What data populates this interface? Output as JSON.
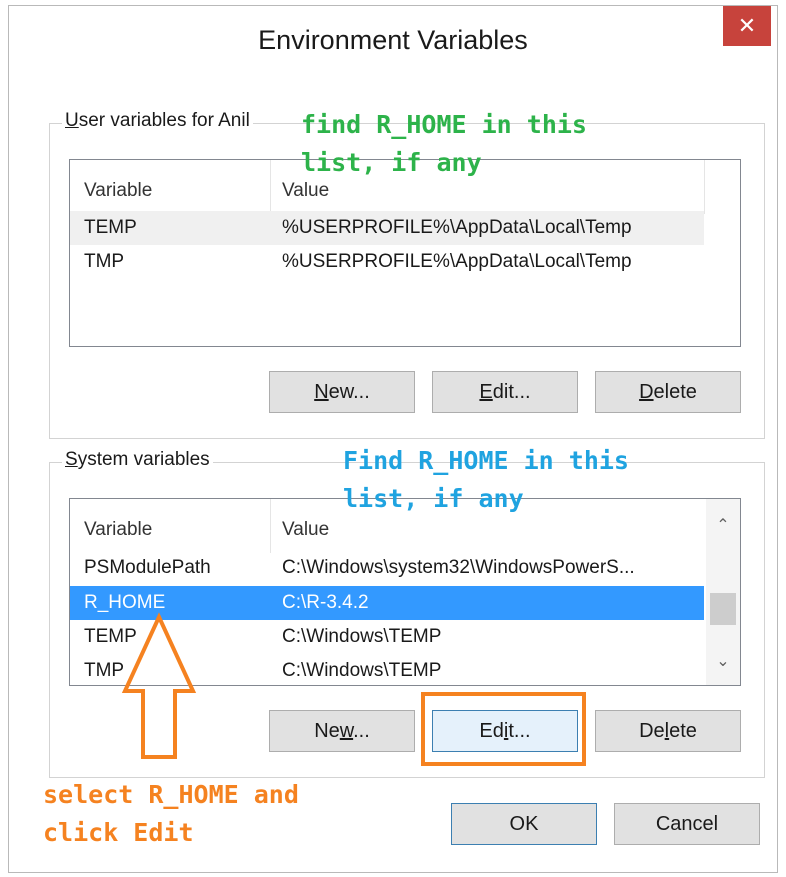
{
  "window": {
    "title": "Environment Variables",
    "close_glyph": "✕"
  },
  "user_group": {
    "label_prefix": "",
    "label_accel": "U",
    "label_rest": "ser variables for Anil",
    "columns": [
      "Variable",
      "Value"
    ],
    "rows": [
      {
        "variable": "TEMP",
        "value": "%USERPROFILE%\\AppData\\Local\\Temp"
      },
      {
        "variable": "TMP",
        "value": "%USERPROFILE%\\AppData\\Local\\Temp"
      }
    ],
    "buttons": {
      "new": {
        "pre": "",
        "accel": "N",
        "post": "ew..."
      },
      "edit": {
        "pre": "",
        "accel": "E",
        "post": "dit..."
      },
      "delete": {
        "pre": "",
        "accel": "D",
        "post": "elete"
      }
    }
  },
  "system_group": {
    "label_prefix": "",
    "label_accel": "S",
    "label_rest": "ystem variables",
    "columns": [
      "Variable",
      "Value"
    ],
    "rows": [
      {
        "variable": "PSModulePath",
        "value": "C:\\Windows\\system32\\WindowsPowerS..."
      },
      {
        "variable": "R_HOME",
        "value": "C:\\R-3.4.2"
      },
      {
        "variable": "TEMP",
        "value": "C:\\Windows\\TEMP"
      },
      {
        "variable": "TMP",
        "value": "C:\\Windows\\TEMP"
      }
    ],
    "selected_row": "R_HOME",
    "buttons": {
      "new": {
        "pre": "Ne",
        "accel": "w",
        "post": "..."
      },
      "edit": {
        "pre": "Ed",
        "accel": "i",
        "post": "t..."
      },
      "delete": {
        "pre": "De",
        "accel": "l",
        "post": "ete"
      }
    }
  },
  "dialog_buttons": {
    "ok": "OK",
    "cancel": "Cancel"
  },
  "annotations": {
    "user_note": "find R_HOME in this\nlist, if any",
    "system_note": "Find R_HOME in this\nlist, if any",
    "action_note": "select R_HOME and\nclick Edit"
  },
  "colors": {
    "annotation_green": "#2db34a",
    "annotation_blue": "#1fa3e0",
    "annotation_orange": "#f58220",
    "selection": "#3399ff",
    "close_button": "#c7433c"
  },
  "icons": {
    "scroll_up": "⌃",
    "scroll_down": "⌄"
  }
}
